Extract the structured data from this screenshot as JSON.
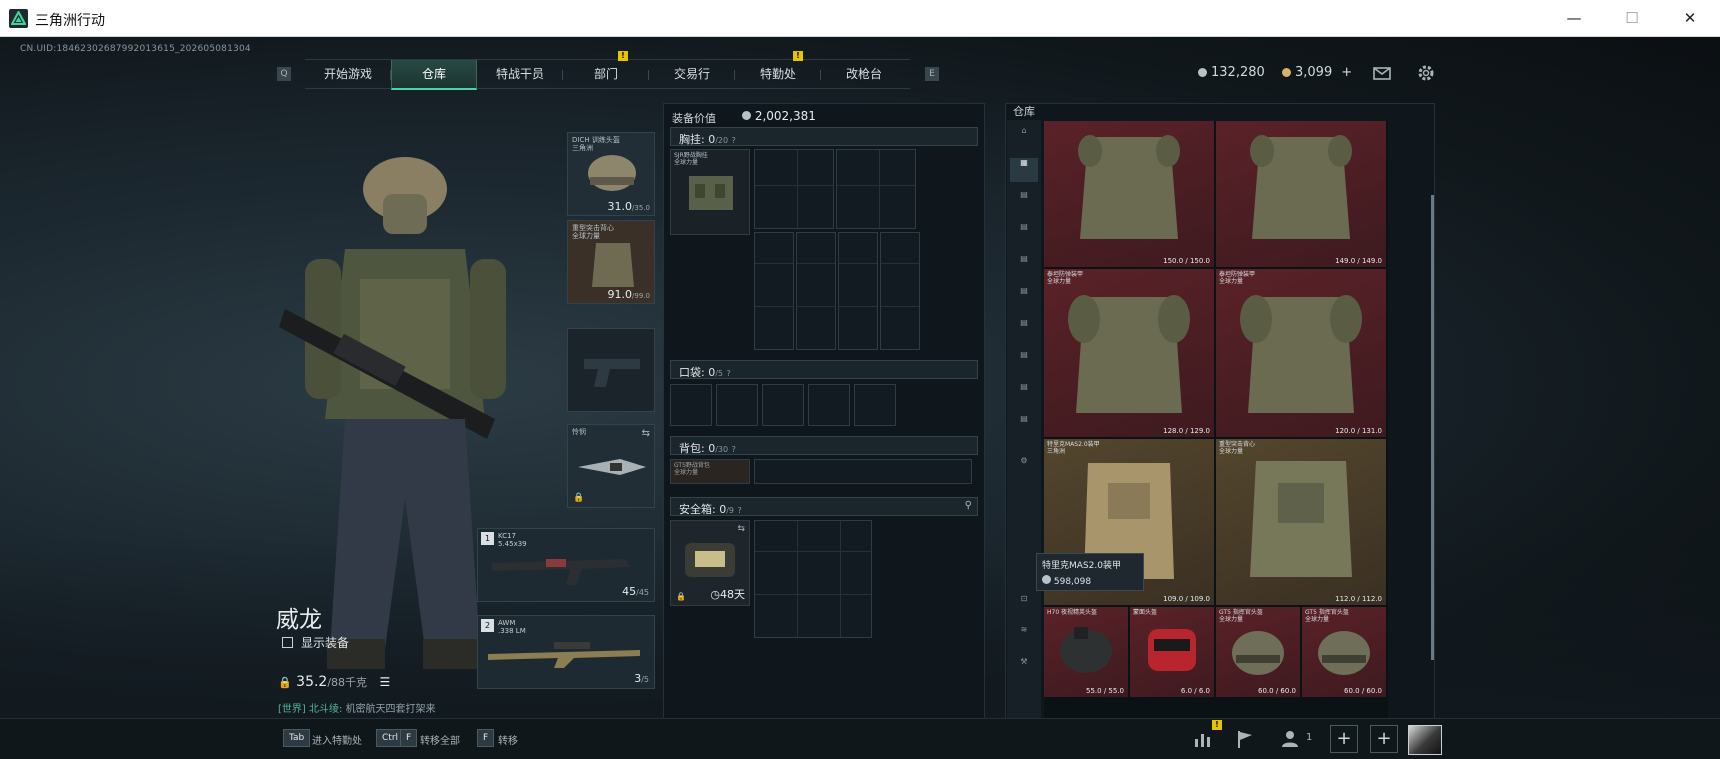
{
  "window": {
    "title": "三角洲行动",
    "minimize": "—",
    "maximize": "☐",
    "close": "✕"
  },
  "uid": "CN.UID:18462302687992013615_202605081304",
  "nav": {
    "left_key": "Q",
    "right_key": "E",
    "tabs": [
      {
        "label": "开始游戏",
        "active": false,
        "badge": ""
      },
      {
        "label": "仓库",
        "active": true,
        "badge": ""
      },
      {
        "label": "特战干员",
        "active": false,
        "badge": ""
      },
      {
        "label": "部门",
        "active": false,
        "badge": "!"
      },
      {
        "label": "交易行",
        "active": false,
        "badge": ""
      },
      {
        "label": "特勤处",
        "active": false,
        "badge": "!"
      },
      {
        "label": "改枪台",
        "active": false,
        "badge": ""
      }
    ]
  },
  "currency": {
    "silver": "132,280",
    "gold": "3,099",
    "gold_plus": "+"
  },
  "icons": {
    "mail": "mail-icon",
    "settings": "gear-icon"
  },
  "operator": {
    "name": "威龙",
    "show_equipment_label": "显示装备",
    "weight_value": "35.2",
    "weight_max": "/88千克",
    "chat_channel": "[世界]",
    "chat_user": "北斗绫:",
    "chat_text": "机密航天四套打架来"
  },
  "slots": {
    "helmet": {
      "name": "DICH 训练头盔",
      "sub": "三角洲",
      "dur": "31.0",
      "max": "/35.0"
    },
    "armor": {
      "name": "重型突击背心",
      "sub": "全球力量",
      "dur": "91.0",
      "max": "/99.0"
    },
    "melee": {
      "name": "怜悯"
    },
    "primary": {
      "num": "1",
      "name": "KC17",
      "cal": "5.45x39",
      "ammo": "45",
      "max": "/45"
    },
    "secondary": {
      "num": "2",
      "name": "AWM",
      "cal": ".338 LM",
      "ammo": "3",
      "max": "/5"
    }
  },
  "loadout": {
    "value_label": "装备价值",
    "value": "2,002,381",
    "chest_label": "胸挂",
    "chest_count": "0",
    "chest_max": "/20",
    "chest_item": "SJR野战胸挂",
    "chest_item_sub": "全球力量",
    "pocket_label": "口袋",
    "pocket_count": "0",
    "pocket_max": "/5",
    "backpack_label": "背包",
    "backpack_count": "0",
    "backpack_max": "/30",
    "backpack_item": "GTS野战背包",
    "backpack_item_sub": "全球力量",
    "safe_label": "安全箱",
    "safe_count": "0",
    "safe_max": "/9",
    "safe_days": "48天",
    "help": "?"
  },
  "warehouse": {
    "title": "仓库",
    "cells": [
      {
        "name": "",
        "dur": "150.0 / 150.0",
        "color": "red"
      },
      {
        "name": "",
        "dur": "149.0 / 149.0",
        "color": "red"
      },
      {
        "name": "泰坦防弹装甲\n全球力量",
        "dur": "128.0 / 129.0",
        "color": "red"
      },
      {
        "name": "泰坦防弹装甲\n全球力量",
        "dur": "120.0 / 131.0",
        "color": "red"
      },
      {
        "name": "特里克MAS2.0装甲\n三角洲",
        "dur": "109.0 / 109.0",
        "color": "tan"
      },
      {
        "name": "重型突击背心\n全球力量",
        "dur": "112.0 / 112.0",
        "color": "tan"
      },
      {
        "name": "H70 夜视精英头盔",
        "dur": "55.0 / 55.0",
        "color": "red"
      },
      {
        "name": "蒙面头盔",
        "dur": "6.0 / 6.0",
        "color": "red"
      },
      {
        "name": "GT5 指挥官头盔\n全球力量",
        "dur": "60.0 / 60.0",
        "color": "red"
      },
      {
        "name": "GT5 指挥官头盔\n全球力量",
        "dur": "60.0 / 60.0",
        "color": "red"
      }
    ],
    "tooltip_name": "特里克MAS2.0装甲",
    "tooltip_value": "598,098"
  },
  "bottom": {
    "tab_key": "Tab",
    "tab_label": "进入特勤处",
    "ctrl_key": "Ctrl",
    "f_key": "F",
    "transfer_all": "转移全部",
    "transfer_key": "F",
    "transfer": "转移",
    "friend_count": "1",
    "badge": "!"
  }
}
